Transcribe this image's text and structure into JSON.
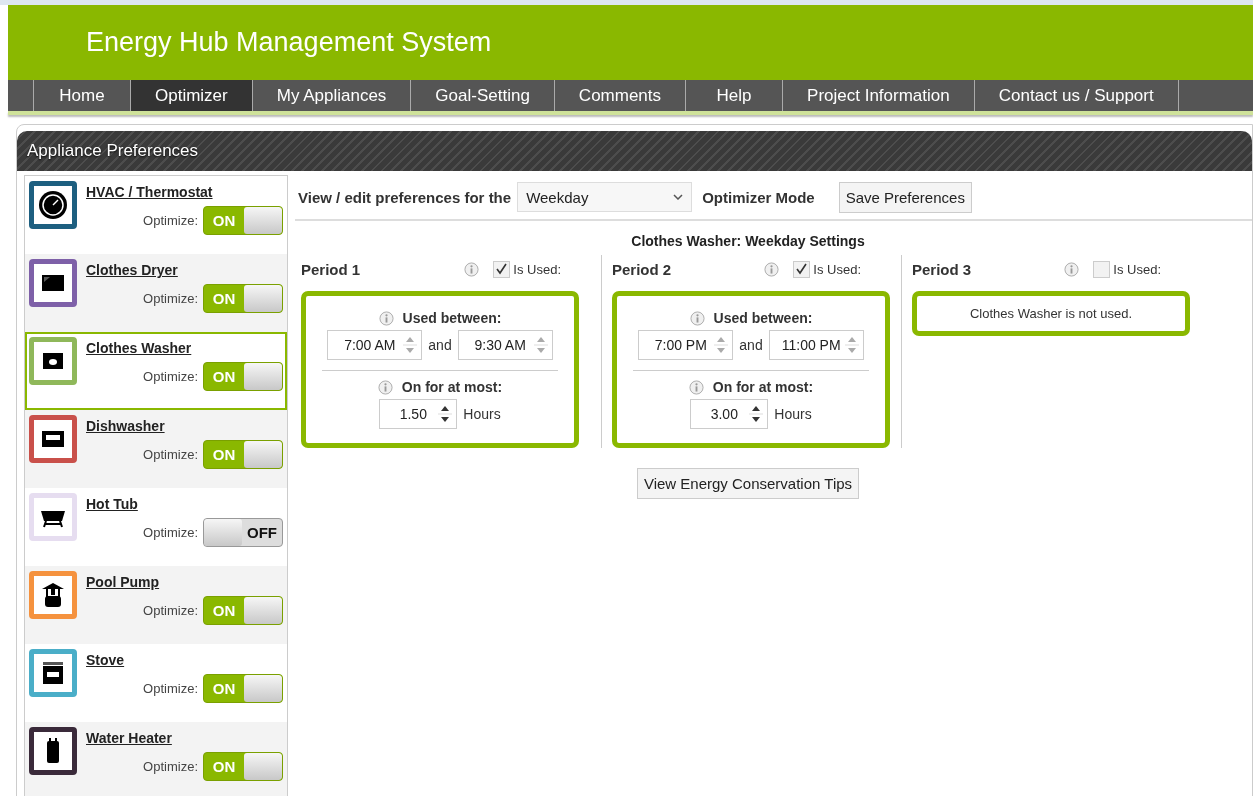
{
  "app_title": "Energy Hub Management System",
  "nav": [
    {
      "label": "Home",
      "selected": false
    },
    {
      "label": "Optimizer",
      "selected": true
    },
    {
      "label": "My Appliances",
      "selected": false
    },
    {
      "label": "Goal-Setting",
      "selected": false
    },
    {
      "label": "Comments",
      "selected": false
    },
    {
      "label": "Help",
      "selected": false
    },
    {
      "label": "Project Information",
      "selected": false
    },
    {
      "label": "Contact us / Support",
      "selected": false
    }
  ],
  "panel_title": "Appliance Preferences",
  "appliances": [
    {
      "name": "HVAC / Thermostat",
      "kind": "thermostat",
      "color": "#1d5f80",
      "optimize_label": "Optimize:",
      "on": true,
      "switch_text": "ON",
      "selected": false
    },
    {
      "name": "Clothes Dryer",
      "kind": "dryer",
      "color": "#7e60a8",
      "optimize_label": "Optimize:",
      "on": true,
      "switch_text": "ON",
      "selected": false
    },
    {
      "name": "Clothes Washer",
      "kind": "washer",
      "color": "#8fb85a",
      "optimize_label": "Optimize:",
      "on": true,
      "switch_text": "ON",
      "selected": true
    },
    {
      "name": "Dishwasher",
      "kind": "dishwasher",
      "color": "#c9504a",
      "optimize_label": "Optimize:",
      "on": true,
      "switch_text": "ON",
      "selected": false
    },
    {
      "name": "Hot Tub",
      "kind": "hottub",
      "color": "#e6ddf0",
      "optimize_label": "Optimize:",
      "on": false,
      "switch_text": "OFF",
      "selected": false
    },
    {
      "name": "Pool Pump",
      "kind": "pump",
      "color": "#f5923e",
      "optimize_label": "Optimize:",
      "on": true,
      "switch_text": "ON",
      "selected": false
    },
    {
      "name": "Stove",
      "kind": "stove",
      "color": "#4aaec8",
      "optimize_label": "Optimize:",
      "on": true,
      "switch_text": "ON",
      "selected": false
    },
    {
      "name": "Water Heater",
      "kind": "heater",
      "color": "#3a2a3a",
      "optimize_label": "Optimize:",
      "on": true,
      "switch_text": "ON",
      "selected": false
    }
  ],
  "toolbar": {
    "prefix": "View / edit preferences for the",
    "day_select": "Weekday",
    "mode_label": "Optimizer Mode",
    "save_button": "Save Preferences"
  },
  "settings_title": "Clothes Washer:  Weekday Settings",
  "periods": [
    {
      "label": "Period 1",
      "used_label": "Is Used:",
      "used": true,
      "between_label": "Used between:",
      "start": "7:00 AM",
      "and_label": "and",
      "end": "9:30 AM",
      "most_label": "On for at most:",
      "hours": "1.50",
      "hours_unit": "Hours"
    },
    {
      "label": "Period 2",
      "used_label": "Is Used:",
      "used": true,
      "between_label": "Used between:",
      "start": "7:00 PM",
      "and_label": "and",
      "end": "11:00 PM",
      "most_label": "On for at most:",
      "hours": "3.00",
      "hours_unit": "Hours"
    },
    {
      "label": "Period 3",
      "used_label": "Is Used:",
      "used": false,
      "message": "Clothes Washer is not used."
    }
  ],
  "tips_button": "View Energy Conservation Tips"
}
